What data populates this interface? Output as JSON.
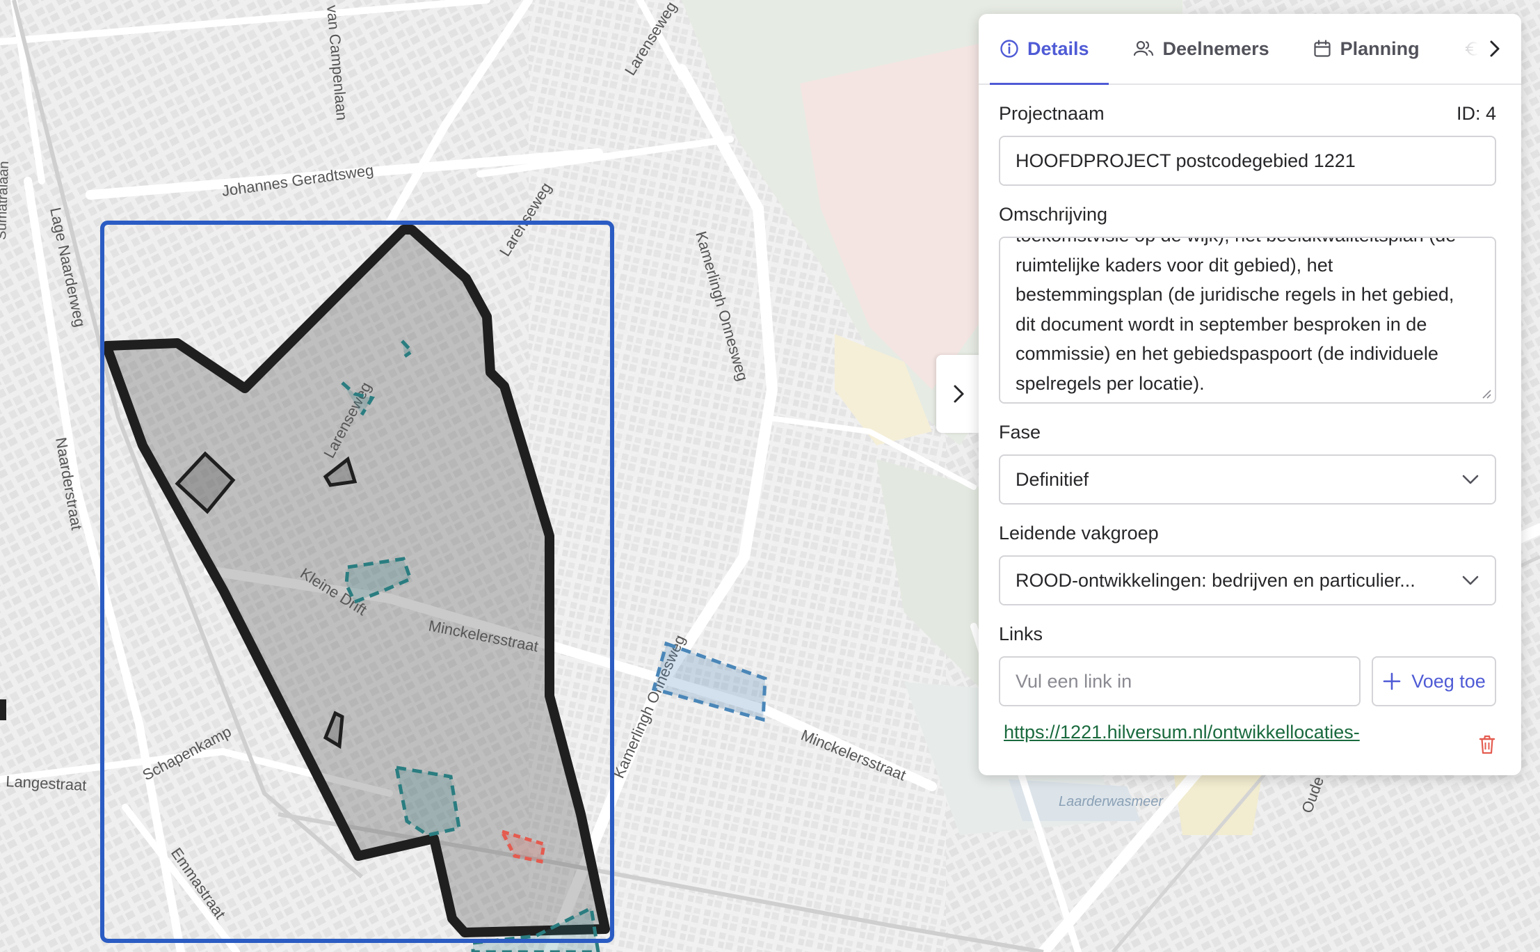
{
  "map": {
    "streets": [
      "van Campenlaan",
      "Larenseweg",
      "Johannes Geradtsweg",
      "Larenseweg",
      "Kamerlingh Onnesweg",
      "Lage Naarderweg",
      "Naarderstraat",
      "Larenseweg",
      "Kleine Drift",
      "Minckelersstraat",
      "Minckelersstraat",
      "Kamerlingh Onnesweg",
      "Schapenkamp",
      "Langestraat",
      "Emmastraat",
      "Oude",
      "Sumatralaan"
    ],
    "water": "Laarderwasmeer",
    "selection_color": "#2b5cc3",
    "project_outline_color": "#1f1f1f",
    "sub_area_colors": [
      "#2a7d80",
      "#4a86b8",
      "#e45b4f"
    ]
  },
  "toggle": {
    "icon": "chevron-right-icon"
  },
  "tabs": [
    {
      "label": "Details",
      "icon": "info-icon",
      "active": true
    },
    {
      "label": "Deelnemers",
      "icon": "users-icon",
      "active": false
    },
    {
      "label": "Planning",
      "icon": "calendar-icon",
      "active": false
    }
  ],
  "form": {
    "project_name_label": "Projectnaam",
    "project_id": "ID: 4",
    "project_name_value": "HOOFDPROJECT postcodegebied 1221",
    "description_label": "Omschrijving",
    "description_lines": [
      "toekomstvisie op de wijk), het beeldkwaliteitsplan (de",
      "ruimtelijke kaders voor dit gebied), het",
      "bestemmingsplan (de juridische regels in het gebied,",
      "dit document wordt in september besproken in de",
      "commissie) en het gebiedspaspoort (de individuele",
      "spelregels per locatie)."
    ],
    "phase_label": "Fase",
    "phase_value": "Definitief",
    "group_label": "Leidende vakgroep",
    "group_value": "ROOD-ontwikkelingen: bedrijven en particulier...",
    "links_label": "Links",
    "link_placeholder": "Vul een link in",
    "add_label": "Voeg toe",
    "link_url": "https://1221.hilversum.nl/ontwikkellocaties-"
  }
}
